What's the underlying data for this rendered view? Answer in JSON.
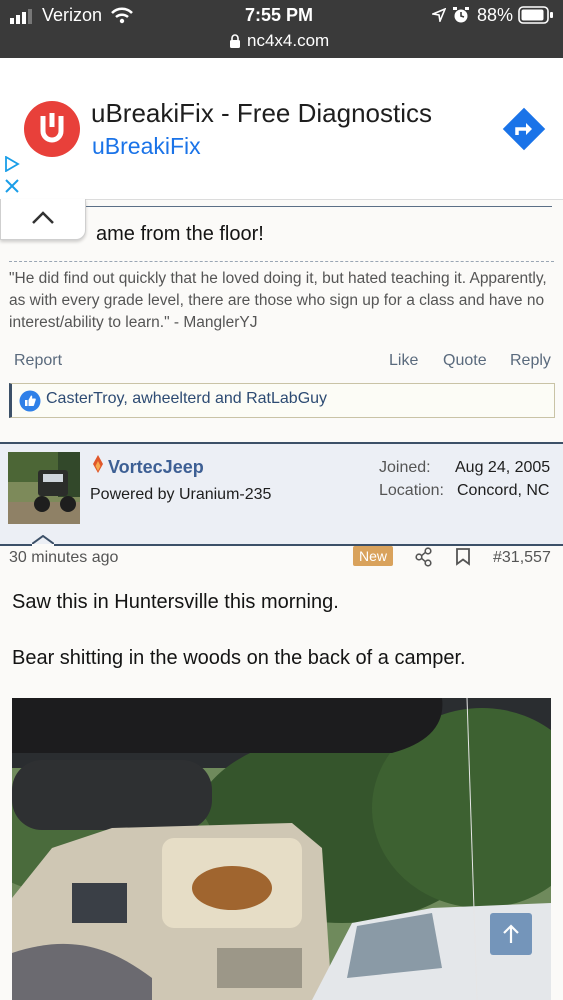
{
  "status_bar": {
    "carrier": "Verizon",
    "time": "7:55 PM",
    "battery": "88%",
    "url": "nc4x4.com"
  },
  "ad": {
    "title": "uBreakiFix - Free Diagnostics",
    "advertiser": "uBreakiFix",
    "logo_letter": "U",
    "brand_color": "#e8403a",
    "link_color": "#1a73e8"
  },
  "post_previous": {
    "body_tail": "ame from the floor!",
    "signature": "\"He did find out quickly that he loved doing it, but hated teaching it. Apparently, as with every grade level, there are those who sign up for a class and have no interest/ability to learn.\" - ManglerYJ",
    "actions": {
      "report": "Report",
      "like": "Like",
      "quote": "Quote",
      "reply": "Reply"
    },
    "reactions": "CasterTroy, awheelterd and RatLabGuy"
  },
  "post": {
    "author": "VortecJeep",
    "user_title": "Powered by Uranium-235",
    "joined_label": "Joined:",
    "joined_value": "Aug 24, 2005",
    "location_label": "Location:",
    "location_value": "Concord, NC",
    "time_ago": "30 minutes ago",
    "new_badge": "New",
    "post_number": "#31,557",
    "line1": "Saw this in Huntersville this morning.",
    "line2": "Bear shitting in the woods on the back of a camper."
  },
  "colors": {
    "accent": "#3c5068",
    "new_badge": "#d9a25c",
    "card_bg": "#eceff5"
  }
}
